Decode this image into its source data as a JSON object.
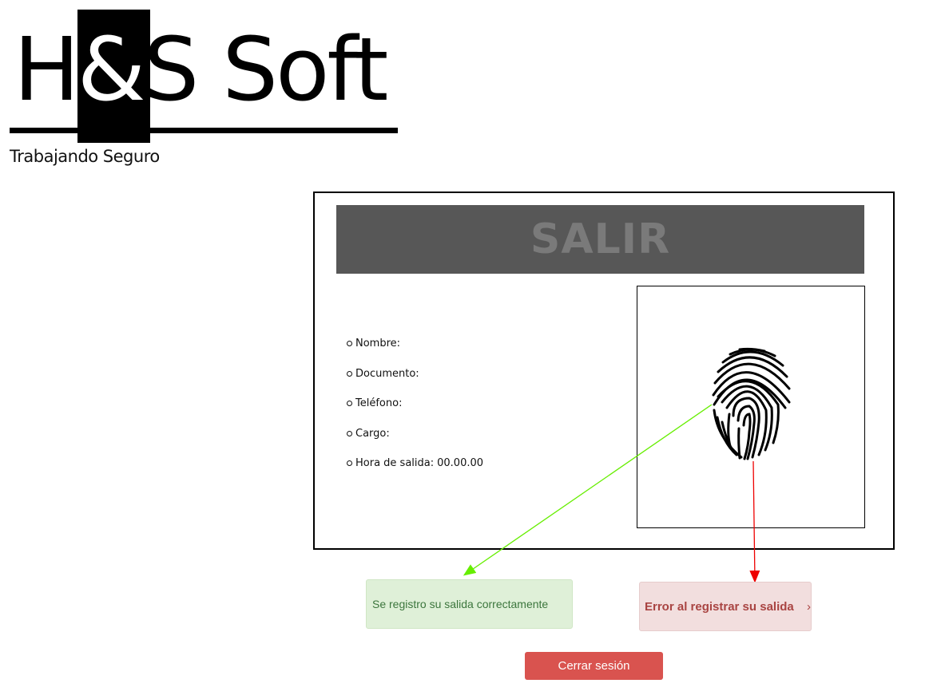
{
  "brand": {
    "logo_text_left": "H",
    "logo_text_amp": "&",
    "logo_text_right": "S Soft",
    "tagline": "Trabajando Seguro"
  },
  "card": {
    "title": "SALIR",
    "fields": [
      {
        "label": "Nombre:",
        "value": ""
      },
      {
        "label": "Documento:",
        "value": ""
      },
      {
        "label": "Teléfono:",
        "value": ""
      },
      {
        "label": "Cargo:",
        "value": ""
      },
      {
        "label": "Hora de salida:",
        "value": "00.00.00"
      }
    ],
    "fingerprint_icon": "fingerprint-icon"
  },
  "alerts": {
    "success": "Se registro su salida correctamente",
    "error": "Error al registrar su salida",
    "error_chevron": "›"
  },
  "actions": {
    "logout_label": "Cerrar sesión"
  },
  "colors": {
    "header_bg": "#575757",
    "success_bg": "#dff0d8",
    "error_bg": "#f2dede",
    "logout_bg": "#d9534f",
    "arrow_success": "#66ee00",
    "arrow_error": "#ee0000"
  }
}
